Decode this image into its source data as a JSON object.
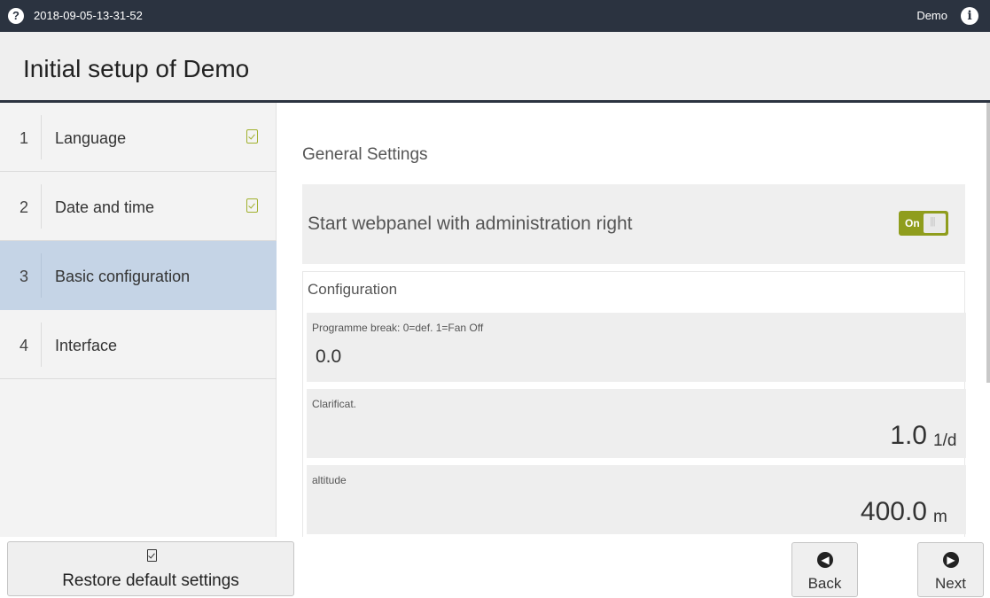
{
  "topbar": {
    "help_glyph": "?",
    "timestamp": "2018-09-05-13-31-52",
    "user": "Demo",
    "info_glyph": "i"
  },
  "title": "Initial setup of Demo",
  "steps": [
    {
      "num": "1",
      "label": "Language",
      "done": true
    },
    {
      "num": "2",
      "label": "Date and time",
      "done": true
    },
    {
      "num": "3",
      "label": "Basic configuration",
      "active": true
    },
    {
      "num": "4",
      "label": "Interface"
    }
  ],
  "general": {
    "title": "General Settings",
    "admin_toggle_label": "Start webpanel with administration right",
    "admin_toggle_state": "On"
  },
  "configuration": {
    "heading": "Configuration",
    "fields": [
      {
        "label": "Programme break: 0=def. 1=Fan Off",
        "value": "0.0",
        "unit": ""
      },
      {
        "label": "Clarificat.",
        "value": "1.0",
        "unit": "1/d"
      },
      {
        "label": "altitude",
        "value": "400.0",
        "unit": "m"
      }
    ]
  },
  "footer": {
    "restore_label": "Restore default settings",
    "back_label": "Back",
    "next_label": "Next",
    "back_glyph": "◀",
    "next_glyph": "▶"
  },
  "colors": {
    "topbar": "#2b3340",
    "active_step": "#c5d4e6",
    "toggle_on": "#8f9d1d",
    "check": "#a0b02c"
  },
  "icons": {
    "help": "question-circle-icon",
    "info": "info-circle-icon",
    "step_done": "document-check-icon",
    "restore": "document-check-icon",
    "back": "arrow-left-circle-icon",
    "next": "arrow-right-circle-icon"
  }
}
